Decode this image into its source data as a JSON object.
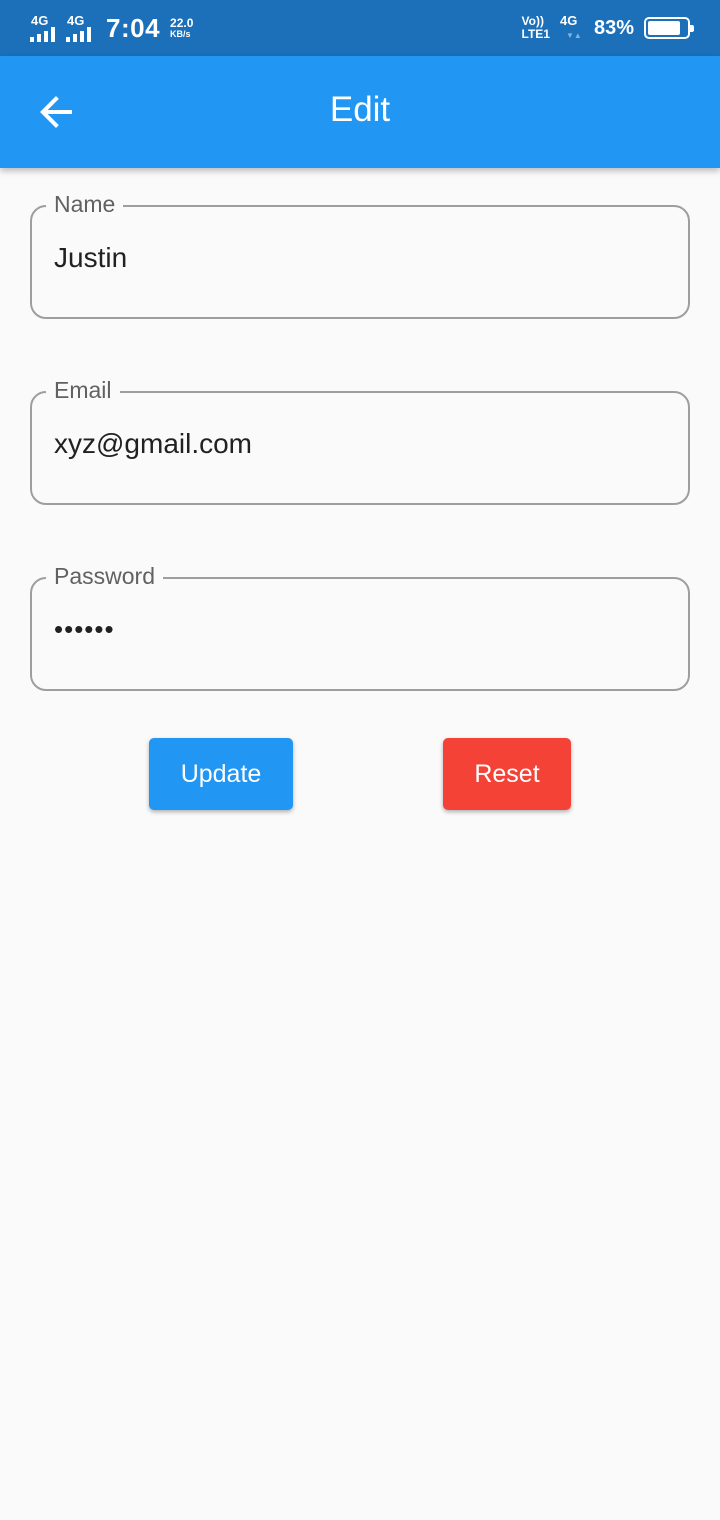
{
  "status_bar": {
    "sim1_type": "4G",
    "sim2_type": "4G",
    "time": "7:04",
    "speed_value": "22.0",
    "speed_unit": "KB/s",
    "volte_top": "Vo))",
    "volte_bottom": "LTE1",
    "net_type": "4G",
    "battery_percent": "83%",
    "battery_level": 0.83
  },
  "app_bar": {
    "title": "Edit",
    "color": "#2196f3"
  },
  "form": {
    "name": {
      "label": "Name",
      "value": "Justin"
    },
    "email": {
      "label": "Email",
      "value": "xyz@gmail.com"
    },
    "password": {
      "label": "Password",
      "value": "••••••"
    }
  },
  "buttons": {
    "update": {
      "label": "Update",
      "color": "#2196f3"
    },
    "reset": {
      "label": "Reset",
      "color": "#f44336"
    }
  }
}
